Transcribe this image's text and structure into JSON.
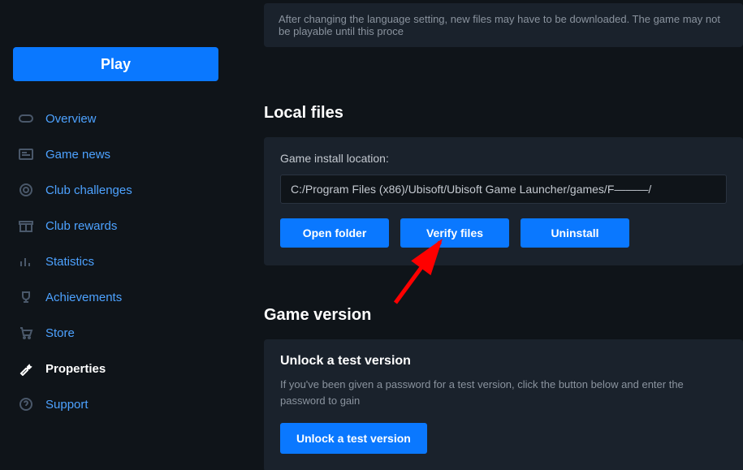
{
  "sidebar": {
    "play_label": "Play",
    "items": [
      {
        "label": "Overview"
      },
      {
        "label": "Game news"
      },
      {
        "label": "Club challenges"
      },
      {
        "label": "Club rewards"
      },
      {
        "label": "Statistics"
      },
      {
        "label": "Achievements"
      },
      {
        "label": "Store"
      },
      {
        "label": "Properties"
      },
      {
        "label": "Support"
      }
    ]
  },
  "info_bar": "After changing the language setting, new files may have to be downloaded. The game may not be playable until this proce",
  "local_files": {
    "title": "Local files",
    "install_label": "Game install location:",
    "install_path": "C:/Program Files (x86)/Ubisoft/Ubisoft Game Launcher/games/F———/",
    "open_folder": "Open folder",
    "verify_files": "Verify files",
    "uninstall": "Uninstall"
  },
  "game_version": {
    "title": "Game version",
    "subtitle": "Unlock a test version",
    "desc": "If you've been given a password for a test version, click the button below and enter the password to gain",
    "button": "Unlock a test version"
  }
}
